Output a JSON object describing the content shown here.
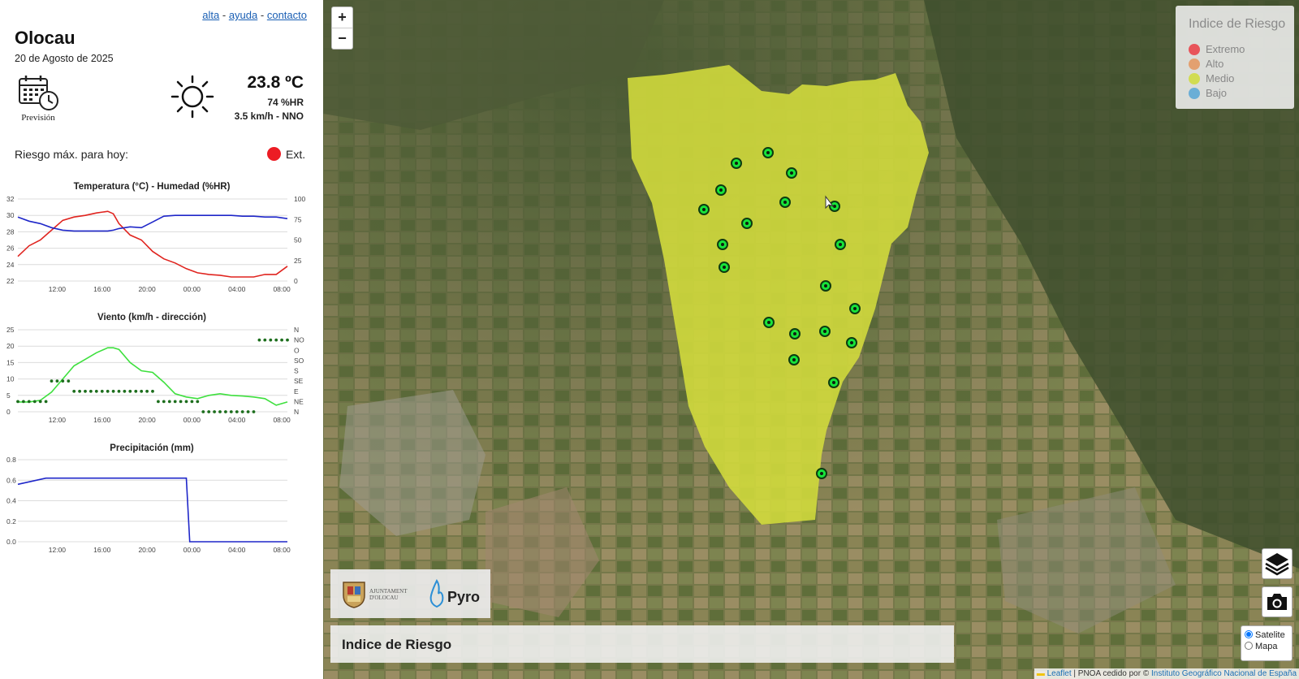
{
  "links": {
    "alta": "alta",
    "sep": "-",
    "ayuda": "ayuda",
    "contacto": "contacto"
  },
  "location": {
    "name": "Olocau",
    "date": "20 de Agosto de 2025"
  },
  "forecast": {
    "label": "Previsión"
  },
  "weather": {
    "temperature": "23.8 ºC",
    "humidity": "74 %HR",
    "wind": "3.5 km/h - NNO"
  },
  "risk": {
    "label": "Riesgo máx. para hoy:",
    "value": "Ext.",
    "color": "#ec1c24"
  },
  "chart_data": [
    {
      "type": "line",
      "title": "Temperatura (°C) - Humedad (%HR)",
      "x_ticks": [
        "12:00",
        "16:00",
        "20:00",
        "00:00",
        "04:00",
        "08:00"
      ],
      "y_ticks_left": [
        "32",
        "30",
        "28",
        "26",
        "24",
        "22"
      ],
      "y_ticks_right": [
        "100",
        "75",
        "50",
        "25",
        "0"
      ],
      "ylim_left": [
        22,
        32
      ],
      "ylim_right": [
        0,
        100
      ],
      "x_hours": [
        8.5,
        9.5,
        10.5,
        11.5,
        12.5,
        13.5,
        14.5,
        15.5,
        16.5,
        17,
        17.5,
        18.5,
        19.5,
        20.5,
        21.5,
        22.5,
        23.5,
        0.5,
        1.5,
        2.5,
        3.5,
        4.5,
        5.5,
        6.5,
        7.5,
        8.5
      ],
      "series": [
        {
          "axis": "left",
          "color": "#e0241f",
          "values": [
            25.0,
            26.3,
            27.0,
            28.2,
            29.4,
            29.8,
            30.0,
            30.3,
            30.5,
            30.2,
            29.0,
            27.6,
            27.0,
            25.6,
            24.7,
            24.2,
            23.5,
            23.0,
            22.8,
            22.7,
            22.5,
            22.5,
            22.5,
            22.8,
            22.8,
            23.8
          ]
        },
        {
          "axis": "right",
          "color": "#1f27c9",
          "values": [
            78,
            73,
            70,
            65,
            62,
            61,
            61,
            61,
            61,
            62,
            64,
            66,
            65,
            72,
            79,
            80,
            80,
            80,
            80,
            80,
            80,
            79,
            79,
            78,
            78,
            76
          ]
        }
      ]
    },
    {
      "type": "line",
      "title": "Viento (km/h - dirección)",
      "x_ticks": [
        "12:00",
        "16:00",
        "20:00",
        "00:00",
        "04:00",
        "08:00"
      ],
      "y_ticks_left": [
        "25",
        "20",
        "15",
        "10",
        "5",
        "0"
      ],
      "y_ticks_right": [
        "N",
        "NO",
        "O",
        "SO",
        "S",
        "SE",
        "E",
        "NE",
        "N"
      ],
      "ylim_left": [
        0,
        25
      ],
      "x_hours": [
        8.5,
        9.5,
        10.5,
        11.5,
        12.5,
        13.5,
        14.5,
        15.5,
        16.5,
        17,
        17.5,
        18.5,
        19.5,
        20.5,
        21.5,
        22.5,
        23.5,
        0.5,
        1.5,
        2.5,
        3.5,
        4.5,
        5.5,
        6.5,
        7.5,
        8.5
      ],
      "series": [
        {
          "name": "Viento",
          "color": "#3ee03e",
          "values": [
            3,
            3,
            3.5,
            6,
            10,
            14,
            16,
            18,
            19.5,
            19.5,
            19,
            15,
            12.5,
            12,
            9,
            5.5,
            4.5,
            4,
            5,
            5.5,
            5,
            4.8,
            4.5,
            4,
            2,
            3
          ]
        }
      ],
      "direction": {
        "color": "#1d6e1d",
        "x_hours": [
          8.5,
          9,
          9.5,
          10,
          10.5,
          11,
          11.5,
          12,
          12.5,
          13,
          13.5,
          14,
          14.5,
          15,
          15.5,
          16,
          16.5,
          17,
          17.5,
          18,
          18.5,
          19,
          19.5,
          20,
          20.5,
          21,
          21.5,
          22,
          22.5,
          23,
          23.5,
          0,
          0.5,
          1,
          1.5,
          2,
          2.5,
          3,
          3.5,
          4,
          4.5,
          5,
          5.5,
          6,
          6.5,
          7,
          7.5,
          8,
          8.5
        ],
        "values": [
          "NE",
          "NE",
          "NE",
          "NE",
          "NE",
          "NE",
          "SE",
          "SE",
          "SE",
          "SE",
          "E",
          "E",
          "E",
          "E",
          "E",
          "E",
          "E",
          "E",
          "E",
          "E",
          "E",
          "E",
          "E",
          "E",
          "E",
          "NE",
          "NE",
          "NE",
          "NE",
          "NE",
          "NE",
          "NE",
          "NE",
          "N",
          "N",
          "N",
          "N",
          "N",
          "N",
          "N",
          "N",
          "N",
          "N",
          "NO",
          "NO",
          "NO",
          "NO",
          "NO",
          "NO"
        ]
      }
    },
    {
      "type": "line",
      "title": "Precipitación (mm)",
      "x_ticks": [
        "12:00",
        "16:00",
        "20:00",
        "00:00",
        "04:00",
        "08:00"
      ],
      "y_ticks_left": [
        "0.8",
        "0.6",
        "0.4",
        "0.2",
        "0.0"
      ],
      "ylim_left": [
        0,
        0.8
      ],
      "x_hours": [
        8.5,
        11,
        23.5,
        23.8,
        8.5
      ],
      "series": [
        {
          "color": "#1f27c9",
          "values": [
            0.56,
            0.62,
            0.62,
            0.0,
            0.0
          ]
        }
      ]
    }
  ],
  "map": {
    "zoom_in": "+",
    "zoom_out": "−",
    "legend": {
      "title": "Indice de Riesgo",
      "items": [
        {
          "label": "Extremo",
          "color": "#e8545a"
        },
        {
          "label": "Alto",
          "color": "#e3a070"
        },
        {
          "label": "Medio",
          "color": "#d1dc52"
        },
        {
          "label": "Bajo",
          "color": "#6aaed6"
        }
      ]
    },
    "layers_icon": "layers-icon",
    "camera_icon": "camera-icon",
    "base_options": [
      "Satelite",
      "Mapa"
    ],
    "base_selected": "Satelite",
    "logos": {
      "ajuntament_line1": "AJUNTAMENT",
      "ajuntament_line2": "D'OLOCAU",
      "pyro": "Pyro"
    },
    "info_title": "Indice de Riesgo",
    "attribution": {
      "leaflet": "Leaflet",
      "sep": " | PNOA cedido por © ",
      "ign": "Instituto Geográfico Nacional de España"
    },
    "risk_zone_color": "#d4dd3c"
  }
}
